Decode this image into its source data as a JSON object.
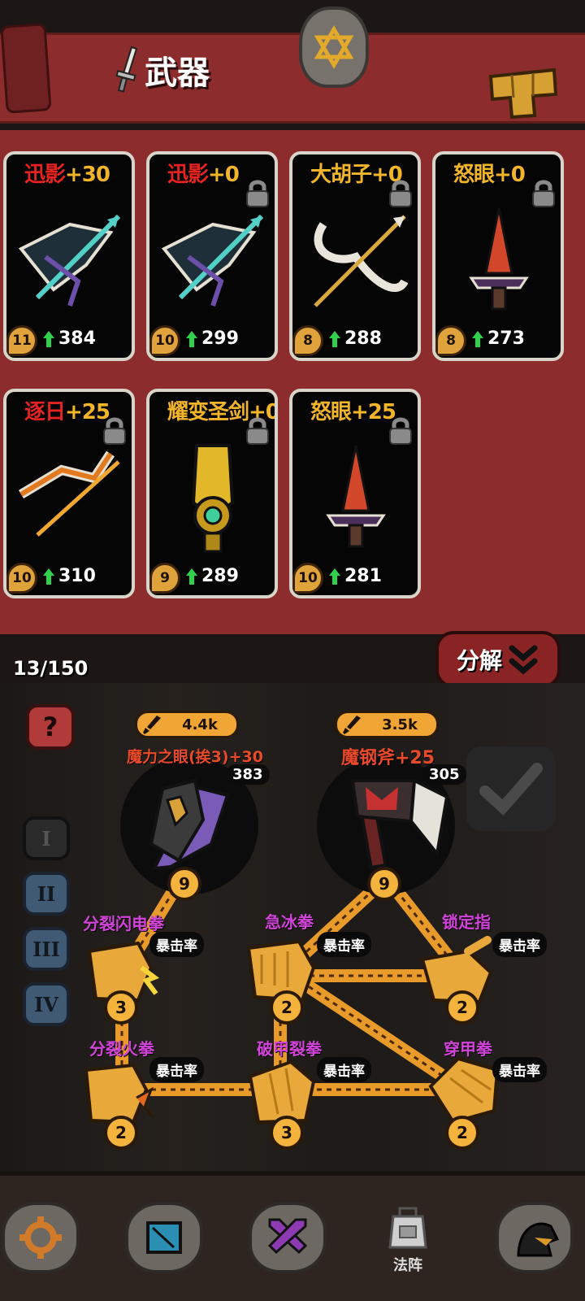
{
  "header": {
    "title": "武器"
  },
  "inventory": {
    "count": "13/150",
    "decompose_label": "分解",
    "cards": [
      {
        "name": "迅影",
        "name_color": "red",
        "plus": "+30",
        "level": "11",
        "power": "384",
        "locked": false,
        "art": "crossbow"
      },
      {
        "name": "迅影",
        "name_color": "red",
        "plus": "+0",
        "level": "10",
        "power": "299",
        "locked": true,
        "art": "crossbow"
      },
      {
        "name": "大胡子",
        "name_color": "gold",
        "plus": "+0",
        "level": "8",
        "power": "288",
        "locked": true,
        "art": "bow"
      },
      {
        "name": "怒眼",
        "name_color": "gold",
        "plus": "+0",
        "level": "8",
        "power": "273",
        "locked": true,
        "art": "dagger"
      },
      {
        "name": "逐日",
        "name_color": "red",
        "plus": "+25",
        "level": "10",
        "power": "310",
        "locked": true,
        "art": "firebow"
      },
      {
        "name": "耀变圣剑",
        "name_color": "gold",
        "plus": "+0",
        "level": "9",
        "power": "289",
        "locked": true,
        "art": "holysword"
      },
      {
        "name": "怒眼",
        "name_color": "gold",
        "plus": "+25",
        "level": "10",
        "power": "281",
        "locked": true,
        "art": "dagger"
      }
    ]
  },
  "board": {
    "help_label": "?",
    "tiers": [
      "I",
      "II",
      "III",
      "IV"
    ],
    "active_tier": 0,
    "weapons": [
      {
        "badge": "4.4k",
        "name": "魔力之眼(挨3)+30",
        "power": "383",
        "level": "9"
      },
      {
        "badge": "3.5k",
        "name": "魔钢斧+25",
        "power": "305",
        "level": "9"
      }
    ],
    "skills": [
      {
        "name": "分裂闪电拳",
        "stat": "暴击率",
        "level": "3"
      },
      {
        "name": "急冰拳",
        "stat": "暴击率",
        "level": "2"
      },
      {
        "name": "锁定指",
        "stat": "暴击率",
        "level": "2"
      },
      {
        "name": "分裂火拳",
        "stat": "暴击率",
        "level": "2"
      },
      {
        "name": "破甲裂拳",
        "stat": "暴击率",
        "level": "3"
      },
      {
        "name": "穿甲拳",
        "stat": "暴击率",
        "level": "2"
      }
    ]
  },
  "nav": {
    "items": [
      {
        "icon": "gear-icon",
        "label": ""
      },
      {
        "icon": "map-icon",
        "label": ""
      },
      {
        "icon": "crossed-swords-icon",
        "label": ""
      },
      {
        "icon": "backpack-icon",
        "label": "法阵"
      },
      {
        "icon": "hood-icon",
        "label": ""
      }
    ]
  },
  "colors": {
    "panel": "#8c2c2c",
    "gold": "#f2b52a",
    "red_name": "#e52321",
    "skill": "#d244d9"
  }
}
